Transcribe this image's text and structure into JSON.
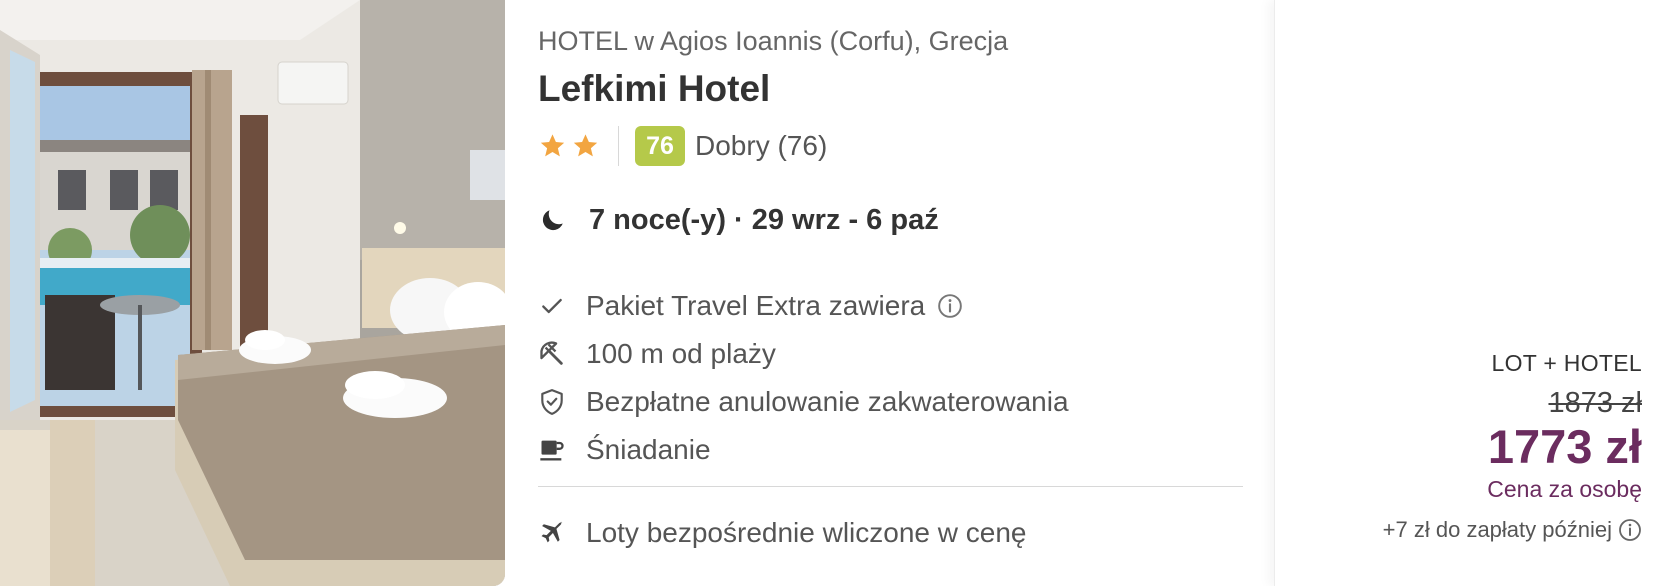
{
  "hotel": {
    "subtitle": "HOTEL w Agios Ioannis (Corfu), Grecja",
    "name": "Lefkimi Hotel",
    "stars": 2,
    "score": "76",
    "score_text": "Dobry (76)",
    "score_color": "#b5c94a",
    "photo_icon": "hotel-room-photo"
  },
  "stay": {
    "icon": "moon-icon",
    "text": "7 noce(-y) · 29 wrz - 6 paź"
  },
  "features": [
    {
      "icon": "check-icon",
      "text": "Pakiet Travel Extra zawiera",
      "has_info": true
    },
    {
      "icon": "beach-umbrella-icon",
      "text": "100 m od plaży",
      "has_info": false
    },
    {
      "icon": "shield-check-icon",
      "text": "Bezpłatne anulowanie zakwaterowania",
      "has_info": false
    },
    {
      "icon": "coffee-cup-icon",
      "text": "Śniadanie",
      "has_info": false
    }
  ],
  "flight": {
    "icon": "airplane-icon",
    "text": "Loty bezpośrednie wliczone w cenę"
  },
  "price": {
    "package_label": "LOT + HOTEL",
    "old_price": "1873 zł",
    "new_price": "1773 zł",
    "per_person": "Cena za osobę",
    "pay_later": "+7 zł do zapłaty później",
    "accent_color": "#6b2c5f"
  }
}
